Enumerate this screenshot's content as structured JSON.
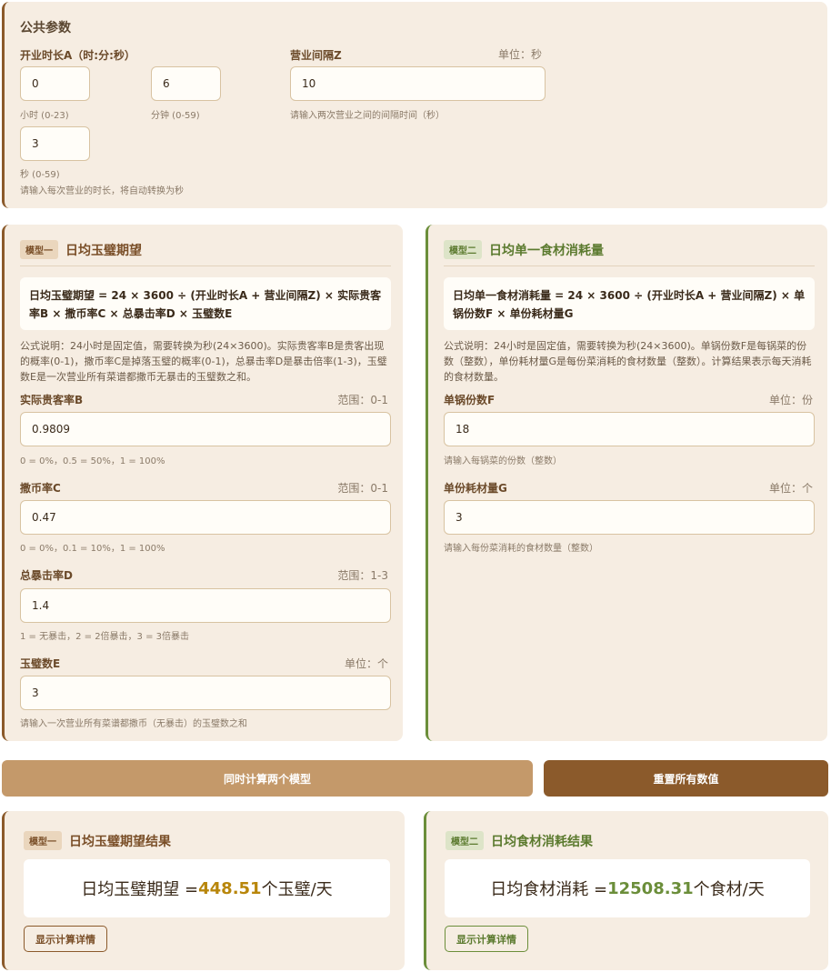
{
  "public": {
    "title": "公共参数",
    "duration_label": "开业时长A（时:分:秒）",
    "hours_value": "0",
    "hours_hint": "小时 (0-23)",
    "minutes_value": "6",
    "minutes_hint": "分钟 (0-59)",
    "seconds_value": "3",
    "seconds_hint": "秒 (0-59)",
    "duration_help": "请输入每次营业的时长，将自动转换为秒",
    "interval_label": "营业间隔Z",
    "interval_unit": "单位：秒",
    "interval_value": "10",
    "interval_help": "请输入两次营业之间的间隔时间（秒）"
  },
  "model1": {
    "tag": "模型一",
    "title": "日均玉璧期望",
    "formula": "日均玉璧期望 = 24 × 3600 ÷ (开业时长A + 营业间隔Z) × 实际贵客率B × 撒币率C × 总暴击率D × 玉璧数E",
    "desc": "公式说明：24小时是固定值，需要转换为秒(24×3600)。实际贵客率B是贵客出现的概率(0-1)，撒币率C是掉落玉璧的概率(0-1)，总暴击率D是暴击倍率(1-3)，玉璧数E是一次营业所有菜谱都撒币无暴击的玉璧数之和。",
    "b_label": "实际贵客率B",
    "b_unit": "范围：0-1",
    "b_value": "0.9809",
    "b_hint": "0 = 0%，0.5 = 50%，1 = 100%",
    "c_label": "撒币率C",
    "c_unit": "范围：0-1",
    "c_value": "0.47",
    "c_hint": "0 = 0%，0.1 = 10%，1 = 100%",
    "d_label": "总暴击率D",
    "d_unit": "范围：1-3",
    "d_value": "1.4",
    "d_hint": "1 = 无暴击，2 = 2倍暴击，3 = 3倍暴击",
    "e_label": "玉璧数E",
    "e_unit": "单位：个",
    "e_value": "3",
    "e_hint": "请输入一次营业所有菜谱都撒币（无暴击）的玉璧数之和"
  },
  "model2": {
    "tag": "模型二",
    "title": "日均单一食材消耗量",
    "formula": "日均单一食材消耗量 = 24 × 3600 ÷ (开业时长A + 营业间隔Z) × 单锅份数F × 单份耗材量G",
    "desc": "公式说明：24小时是固定值，需要转换为秒(24×3600)。单锅份数F是每锅菜的份数（整数），单份耗材量G是每份菜消耗的食材数量（整数）。计算结果表示每天消耗的食材数量。",
    "f_label": "单锅份数F",
    "f_unit": "单位：份",
    "f_value": "18",
    "f_hint": "请输入每锅菜的份数（整数）",
    "g_label": "单份耗材量G",
    "g_unit": "单位：个",
    "g_value": "3",
    "g_hint": "请输入每份菜消耗的食材数量（整数）"
  },
  "actions": {
    "calc_label": "同时计算两个模型",
    "reset_label": "重置所有数值"
  },
  "result1": {
    "tag": "模型一",
    "title": "日均玉璧期望结果",
    "prefix": "日均玉璧期望 =",
    "value": "448.51",
    "suffix": "个玉璧/天",
    "detail_label": "显示计算详情"
  },
  "result2": {
    "tag": "模型二",
    "title": "日均食材消耗结果",
    "prefix": "日均食材消耗 =",
    "value": "12508.31",
    "suffix": "个食材/天",
    "detail_label": "显示计算详情"
  },
  "colors": {
    "brown_accent": "#8b5a2b",
    "green_accent": "#6b8e3a",
    "gold_value": "#b8860b",
    "card_bg": "#f6ede2"
  }
}
